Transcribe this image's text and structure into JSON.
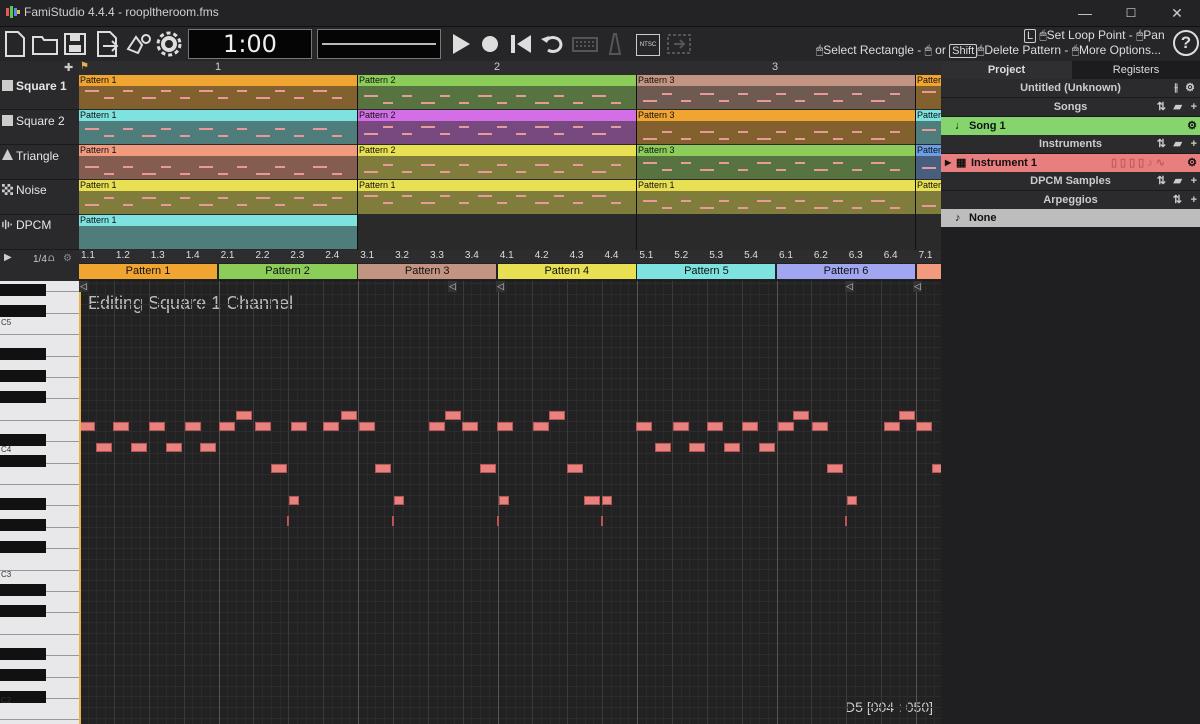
{
  "window": {
    "title": "FamiStudio 4.4.4 - roopltheroom.fms",
    "minimize": "—",
    "maximize": "☐",
    "close": "✕"
  },
  "toolbar": {
    "time": "1:00",
    "hint_line1_a": "Set Loop Point - ",
    "hint_line1_b": "Pan",
    "hint_line2_a": "Select Rectangle - ",
    "hint_line2_or": "or",
    "hint_shift": "Shift",
    "hint_line2_b": "Delete Pattern - ",
    "hint_line2_c": "More Options...",
    "key_L": "L",
    "ntsc": "NTSC",
    "help": "?"
  },
  "timeline": {
    "bar_labels": [
      "1",
      "2",
      "3"
    ]
  },
  "channels": [
    {
      "name": "Square 1"
    },
    {
      "name": "Square 2"
    },
    {
      "name": "Triangle"
    },
    {
      "name": "Noise"
    },
    {
      "name": "DPCM"
    }
  ],
  "patterns": {
    "square1": [
      "Pattern 1",
      "Pattern 2",
      "Pattern 3",
      "Patter"
    ],
    "square2": [
      "Pattern 1",
      "Pattern 2",
      "Pattern 3",
      "Patter"
    ],
    "triangle": [
      "Pattern 1",
      "Pattern 2",
      "Pattern 3",
      "Patter"
    ],
    "noise": [
      "Pattern 1",
      "Pattern 1",
      "Pattern 1",
      "Patter"
    ],
    "dpcm": [
      "Pattern 1"
    ]
  },
  "piano_roll": {
    "zoom_label": "1/4",
    "beat_labels": [
      "1.1",
      "1.2",
      "1.3",
      "1.4",
      "2.1",
      "2.2",
      "2.3",
      "2.4",
      "3.1",
      "3.2",
      "3.3",
      "3.4",
      "4.1",
      "4.2",
      "4.3",
      "4.4",
      "5.1",
      "5.2",
      "5.3",
      "5.4",
      "6.1",
      "6.2",
      "6.3",
      "6.4",
      "7.1"
    ],
    "pattern_tabs": [
      "Pattern 1",
      "Pattern 2",
      "Pattern 3",
      "Pattern 4",
      "Pattern 5",
      "Pattern 6"
    ],
    "editing_label": "Editing Square 1 Channel",
    "status": "D5 [004 : 050]",
    "octave_labels": [
      "C5",
      "C4",
      "C3",
      "C2"
    ]
  },
  "project_panel": {
    "tabs": [
      "Project",
      "Registers"
    ],
    "project_title": "Untitled (Unknown)",
    "songs_header": "Songs",
    "song": "Song 1",
    "instruments_header": "Instruments",
    "instrument": "Instrument 1",
    "dpcm_header": "DPCM Samples",
    "arpeggios_header": "Arpeggios",
    "arpeggio": "None"
  },
  "colors": {
    "orange": "#f0a532",
    "green": "#8ccd5a",
    "brown": "#c49482",
    "cyan": "#7de2e0",
    "magenta": "#d46ee6",
    "salmon": "#f19a7e",
    "yellow": "#e8e052",
    "blue": "#6a9ee6",
    "song_green": "#86d46e",
    "instrument_red": "#e97e7e"
  }
}
